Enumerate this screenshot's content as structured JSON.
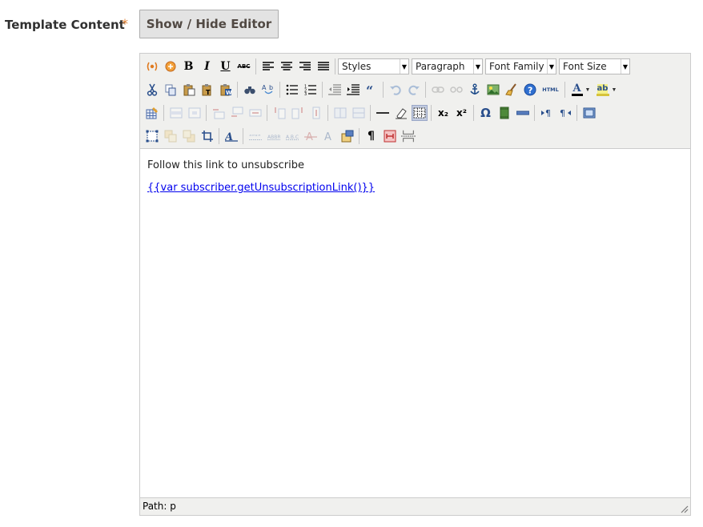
{
  "field": {
    "label": "Template Content",
    "required_mark": "*"
  },
  "editor_toggle_label": "Show / Hide Editor",
  "toolbar": {
    "styles_select": "Styles",
    "format_select": "Paragraph",
    "font_family_select": "Font Family",
    "font_size_select": "Font Size",
    "bold_glyph": "B",
    "italic_glyph": "I",
    "underline_glyph": "U",
    "strike_glyph": "ABC",
    "html_button": "HTML",
    "font_color_glyph": "A",
    "highlight_glyph": "ab",
    "subscript_glyph": "x₂",
    "superscript_glyph": "x²",
    "omega_glyph": "Ω",
    "pilcrow_glyph": "¶"
  },
  "content": {
    "paragraph": "Follow this link to unsubscribe",
    "link": "{{var subscriber.getUnsubscriptionLink()}}"
  },
  "statusbar": {
    "path": "Path: p"
  }
}
